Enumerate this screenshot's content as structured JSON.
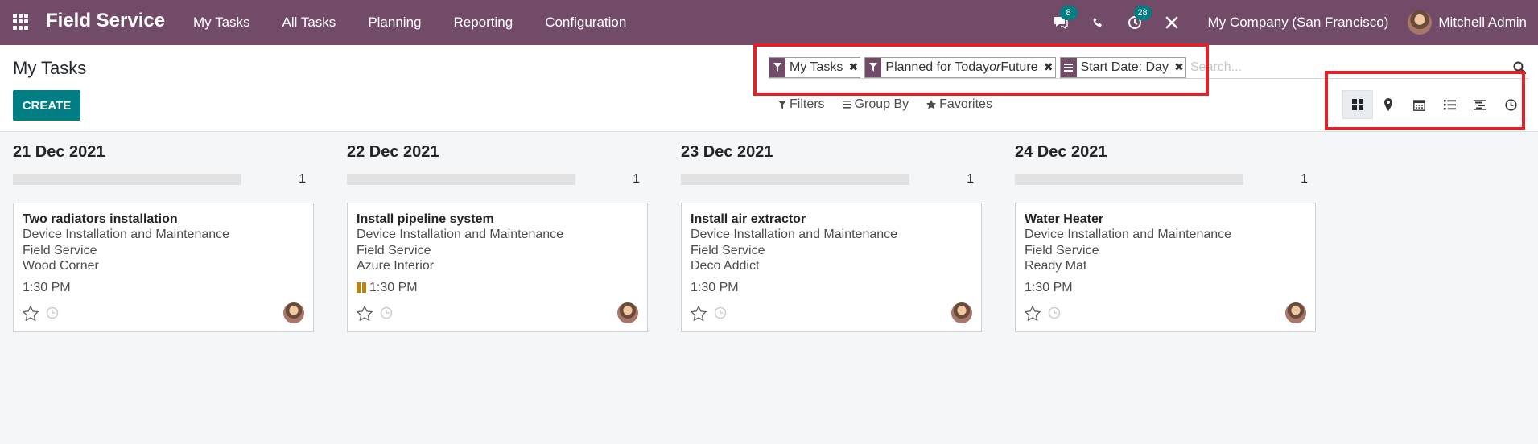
{
  "app": {
    "brand": "Field Service"
  },
  "nav": {
    "menu": [
      "My Tasks",
      "All Tasks",
      "Planning",
      "Reporting",
      "Configuration"
    ],
    "messages_count": "8",
    "activities_count": "28",
    "company": "My Company (San Francisco)",
    "user": "Mitchell Admin"
  },
  "control": {
    "title": "My Tasks",
    "create_label": "CREATE",
    "facets": [
      {
        "icon": "filter-icon",
        "label": "My Tasks"
      },
      {
        "icon": "filter-icon",
        "label_parts": [
          "Planned for Today ",
          "or",
          " Future"
        ]
      },
      {
        "icon": "groupby-icon",
        "label": "Start Date: Day"
      }
    ],
    "search_placeholder": "Search...",
    "filters_label": "Filters",
    "groupby_label": "Group By",
    "favorites_label": "Favorites",
    "views": [
      "kanban-view-icon",
      "map-view-icon",
      "calendar-view-icon",
      "list-view-icon",
      "gantt-view-icon",
      "activity-view-icon"
    ],
    "active_view": "kanban-view-icon"
  },
  "columns": [
    {
      "date": "21 Dec 2021",
      "count": "1",
      "card": {
        "title": "Two radiators installation",
        "lines": [
          "Device Installation and Maintenance",
          "Field Service",
          "Wood Corner"
        ],
        "time": "1:30 PM",
        "paused": false
      }
    },
    {
      "date": "22 Dec 2021",
      "count": "1",
      "card": {
        "title": "Install pipeline system",
        "lines": [
          "Device Installation and Maintenance",
          "Field Service",
          "Azure Interior"
        ],
        "time": "1:30 PM",
        "paused": true
      }
    },
    {
      "date": "23 Dec 2021",
      "count": "1",
      "card": {
        "title": "Install air extractor",
        "lines": [
          "Device Installation and Maintenance",
          "Field Service",
          "Deco Addict"
        ],
        "time": "1:30 PM",
        "paused": false
      }
    },
    {
      "date": "24 Dec 2021",
      "count": "1",
      "card": {
        "title": "Water Heater",
        "lines": [
          "Device Installation and Maintenance",
          "Field Service",
          "Ready Mat"
        ],
        "time": "1:30 PM",
        "paused": false
      }
    }
  ],
  "colors": {
    "navbar": "#714b67",
    "primary": "#017e84",
    "highlight": "#e0222a"
  }
}
